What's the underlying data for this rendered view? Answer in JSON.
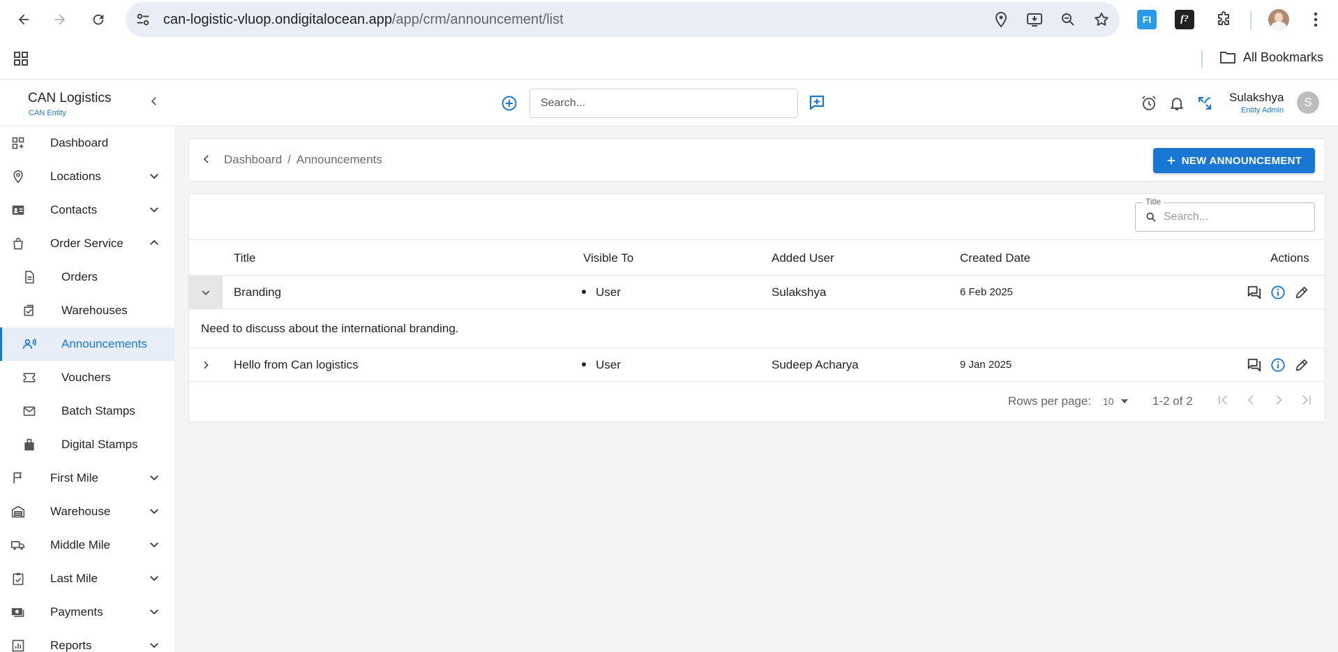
{
  "browser": {
    "url_domain": "can-logistic-vluop.ondigitalocean.app",
    "url_path": "/app/crm/announcement/list",
    "bookmarks_label": "All Bookmarks",
    "extensions": [
      "FI",
      "f?"
    ]
  },
  "header": {
    "brand": "CAN Logistics",
    "brand_sub": "CAN Entity",
    "search_placeholder": "Search...",
    "user_name": "Sulakshya",
    "user_role": "Entity Admin",
    "avatar_initial": "S"
  },
  "sidebar": {
    "items": [
      {
        "label": "Dashboard",
        "icon": "dashboard-icon"
      },
      {
        "label": "Locations",
        "icon": "location-pin-icon"
      },
      {
        "label": "Contacts",
        "icon": "contacts-card-icon"
      },
      {
        "label": "Order Service",
        "icon": "shopping-bag-icon"
      },
      {
        "label": "Orders",
        "icon": "document-icon"
      },
      {
        "label": "Warehouses",
        "icon": "warehouse-check-icon"
      },
      {
        "label": "Announcements",
        "icon": "announcement-icon"
      },
      {
        "label": "Vouchers",
        "icon": "voucher-icon"
      },
      {
        "label": "Batch Stamps",
        "icon": "mail-icon"
      },
      {
        "label": "Digital Stamps",
        "icon": "stamp-icon"
      },
      {
        "label": "First Mile",
        "icon": "flag-icon"
      },
      {
        "label": "Warehouse",
        "icon": "garage-icon"
      },
      {
        "label": "Middle Mile",
        "icon": "truck-icon"
      },
      {
        "label": "Last Mile",
        "icon": "clipboard-check-icon"
      },
      {
        "label": "Payments",
        "icon": "payments-icon"
      },
      {
        "label": "Reports",
        "icon": "reports-icon"
      }
    ]
  },
  "breadcrumb": {
    "parent": "Dashboard",
    "separator": "/",
    "current": "Announcements"
  },
  "new_button_label": "NEW ANNOUNCEMENT",
  "filter": {
    "legend": "Title",
    "placeholder": "Search..."
  },
  "table": {
    "columns": [
      "Title",
      "Visible To",
      "Added User",
      "Created Date",
      "Actions"
    ],
    "rows": [
      {
        "title": "Branding",
        "visible_to": "User",
        "added_user": "Sulakshya",
        "created_date": "6 Feb 2025",
        "expanded": true,
        "detail": "Need to discuss about the international branding."
      },
      {
        "title": "Hello from Can logistics",
        "visible_to": "User",
        "added_user": "Sudeep Acharya",
        "created_date": "9 Jan 2025",
        "expanded": false
      }
    ]
  },
  "pagination": {
    "rows_per_page_label": "Rows per page:",
    "rows_per_page": "10",
    "range": "1-2 of 2"
  },
  "colors": {
    "accent": "#1976d2",
    "active_bg": "#e8eef8"
  }
}
